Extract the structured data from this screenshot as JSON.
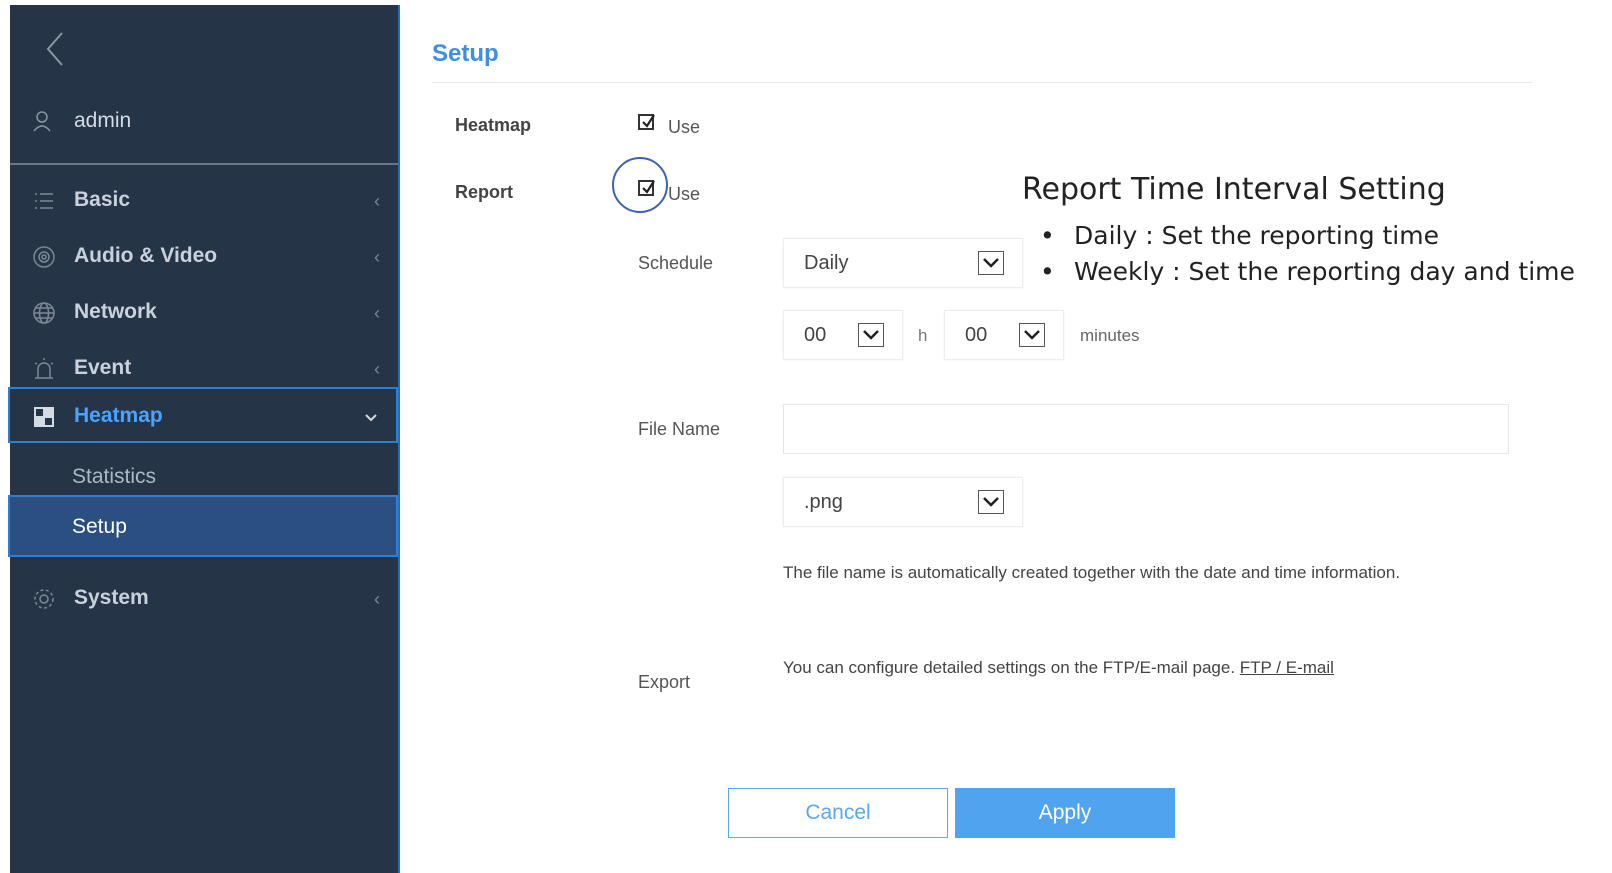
{
  "sidebar": {
    "user": "admin",
    "items": [
      {
        "label": "Basic"
      },
      {
        "label": "Audio & Video"
      },
      {
        "label": "Network"
      },
      {
        "label": "Event"
      },
      {
        "label": "Heatmap"
      },
      {
        "label": "System"
      }
    ],
    "sub_items": [
      {
        "label": "Statistics"
      },
      {
        "label": "Setup"
      }
    ]
  },
  "main": {
    "title": "Setup",
    "heatmap": {
      "label": "Heatmap",
      "use_label": "Use",
      "checked": true
    },
    "report": {
      "label": "Report",
      "use_label": "Use",
      "checked": true
    },
    "schedule": {
      "label": "Schedule",
      "value": "Daily"
    },
    "time": {
      "hour": "00",
      "hour_unit": "h",
      "minute": "00",
      "minute_unit": "minutes"
    },
    "file_name": {
      "label": "File Name",
      "value": "",
      "format": ".png",
      "note": "The file name is automatically created together with the date and time information."
    },
    "export": {
      "label": "Export",
      "note": "You can configure detailed settings on the FTP/E-mail page.",
      "link": "FTP / E-mail"
    },
    "buttons": {
      "cancel": "Cancel",
      "apply": "Apply"
    }
  },
  "annotation": {
    "title": "Report Time Interval Setting",
    "bullets": [
      "Daily : Set the reporting time",
      "Weekly : Set the reporting day and time"
    ]
  },
  "colors": {
    "sidebar_bg": "#263448",
    "accent": "#3d8fe0",
    "apply_bg": "#4fa3ef"
  }
}
